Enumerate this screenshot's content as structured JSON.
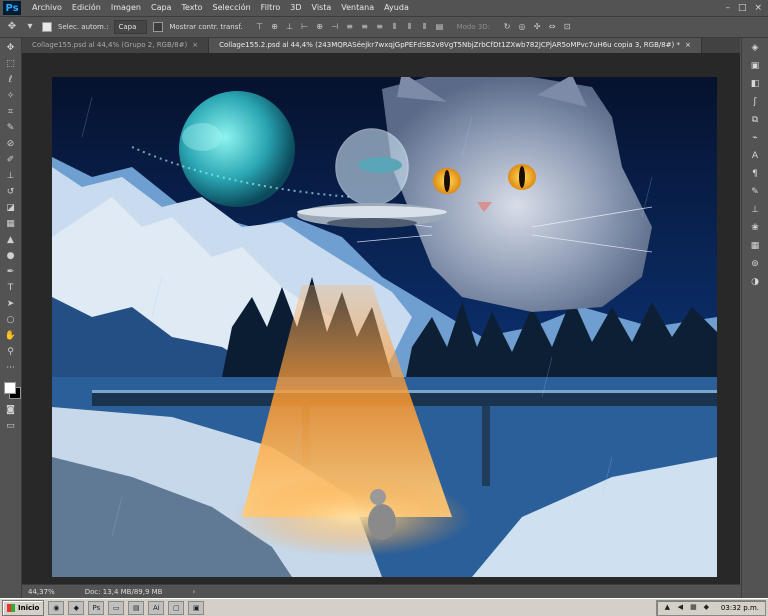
{
  "menubar": {
    "logo": "Ps",
    "items": [
      "Archivo",
      "Edición",
      "Imagen",
      "Capa",
      "Texto",
      "Selección",
      "Filtro",
      "3D",
      "Vista",
      "Ventana",
      "Ayuda"
    ]
  },
  "options": {
    "auto_select_label": "Selec. autom.:",
    "auto_select_value": "Capa",
    "transform_label": "Mostrar contr. transf.",
    "mode3d_label": "Modo 3D:"
  },
  "tabs": [
    {
      "label": "Collage155.psd al 44,4% (Grupo 2, RGB/8#)",
      "close": "×"
    },
    {
      "label": "Collage155.2.psd al 44,4% (243MQRASéejkr7wxqjGpPEFdSB2v8VgT5NbjZrbCfDt1ZXwb782JCPjAR5oMPvc7uH6u copia 3, RGB/8#) *",
      "close": "×"
    }
  ],
  "status": {
    "zoom": "44,37%",
    "doc": "Doc: 13,4 MB/89,9 MB",
    "arrow": "›"
  },
  "taskbar": {
    "start": "Inicio",
    "clock": "03:32 p.m."
  },
  "colors": {
    "ui_bg": "#535353",
    "workspace": "#282828",
    "accent": "#31a8ff",
    "taskbar": "#d4d0c8"
  }
}
